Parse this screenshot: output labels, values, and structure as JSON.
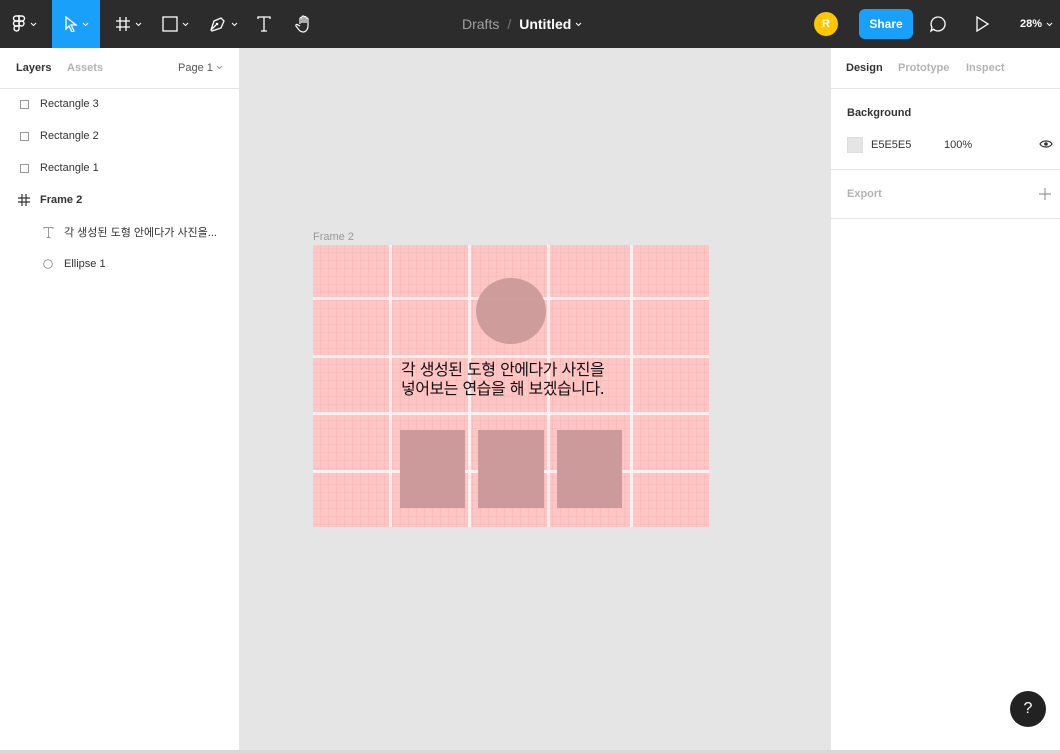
{
  "toolbar": {
    "breadcrumb_drafts": "Drafts",
    "breadcrumb_sep": "/",
    "file_name": "Untitled",
    "avatar_initial": "R",
    "share_label": "Share",
    "zoom": "28%",
    "accent_color": "#18a0fb"
  },
  "left_panel": {
    "tab_layers": "Layers",
    "tab_assets": "Assets",
    "page_selector": "Page 1",
    "layers": [
      {
        "label": "Rectangle 3",
        "icon": "rectangle-icon"
      },
      {
        "label": "Rectangle 2",
        "icon": "rectangle-icon"
      },
      {
        "label": "Rectangle 1",
        "icon": "rectangle-icon"
      },
      {
        "label": "Frame 2",
        "icon": "frame-icon"
      },
      {
        "label": "각 생성된 도형 안에다가 사진을...",
        "icon": "text-icon"
      },
      {
        "label": "Ellipse 1",
        "icon": "ellipse-icon"
      }
    ]
  },
  "canvas": {
    "frame_label": "Frame 2",
    "frame_text_line1": "각 생성된 도형 안에다가 사진을",
    "frame_text_line2": "넣어보는 연습을 해 보겠습니다."
  },
  "right_panel": {
    "tab_design": "Design",
    "tab_prototype": "Prototype",
    "tab_inspect": "Inspect",
    "background_title": "Background",
    "background_hex": "E5E5E5",
    "background_opacity": "100%",
    "export_title": "Export"
  },
  "help_label": "?"
}
